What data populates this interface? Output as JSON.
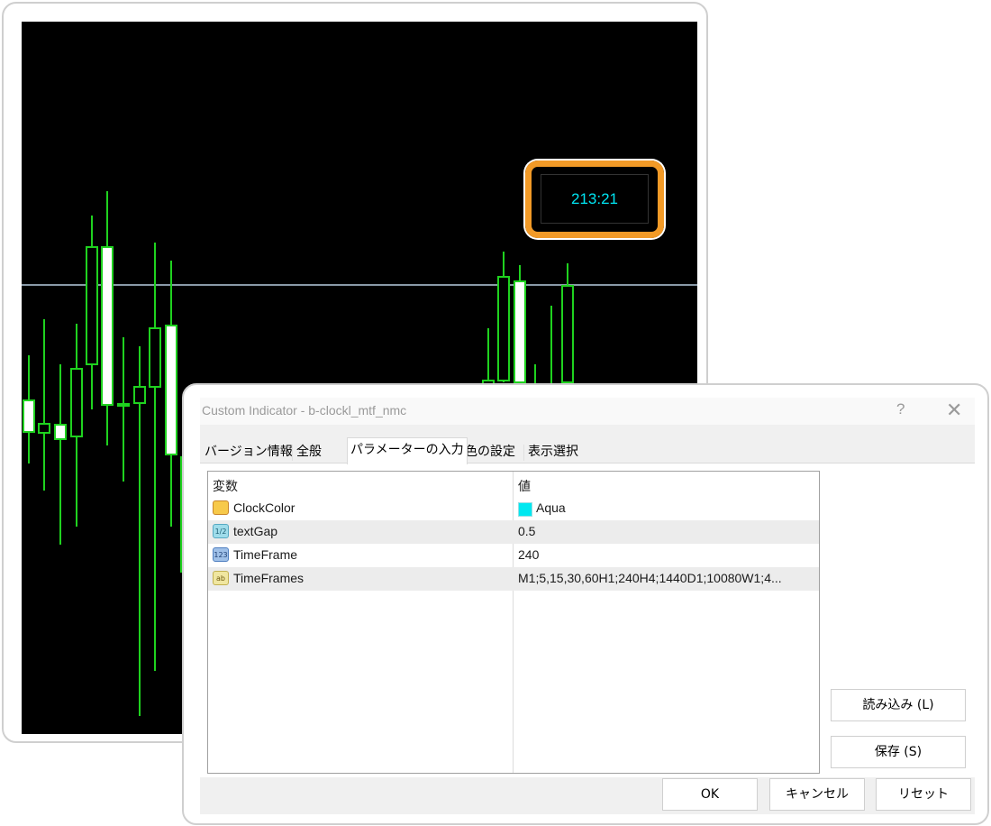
{
  "chart": {
    "clock_value": "213:21",
    "clock_color": "#00e5f2",
    "candle_color": "#1fd21f",
    "bull_body_color": "#ffffff",
    "horizontal_line_color": "#8a9aa8",
    "highlight_color": "#f29a27"
  },
  "dialog": {
    "title": "Custom Indicator - b-clockl_mtf_nmc",
    "help_icon": "?",
    "close_icon": "✕",
    "tabs": [
      {
        "label": "バージョン情報"
      },
      {
        "label": "全般"
      },
      {
        "label": "パラメーターの入力"
      },
      {
        "label": "色の設定"
      },
      {
        "label": "表示選択"
      }
    ],
    "active_tab": "パラメーターの入力",
    "table": {
      "headers": {
        "name": "変数",
        "value": "値"
      },
      "rows": [
        {
          "icon": "color-type-icon",
          "name": "ClockColor",
          "value": "Aqua",
          "swatch": "#00e8f0"
        },
        {
          "icon": "double-type-icon",
          "icon_text": "1/2",
          "name": "textGap",
          "value": "0.5"
        },
        {
          "icon": "int-type-icon",
          "icon_text": "123",
          "name": "TimeFrame",
          "value": "240"
        },
        {
          "icon": "string-type-icon",
          "icon_text": "ab",
          "name": "TimeFrames",
          "value": "M1;5,15,30,60H1;240H4;1440D1;10080W1;4..."
        }
      ]
    },
    "buttons": {
      "load": "読み込み (L)",
      "save": "保存 (S)",
      "ok": "OK",
      "cancel": "キャンセル",
      "reset": "リセット"
    }
  }
}
